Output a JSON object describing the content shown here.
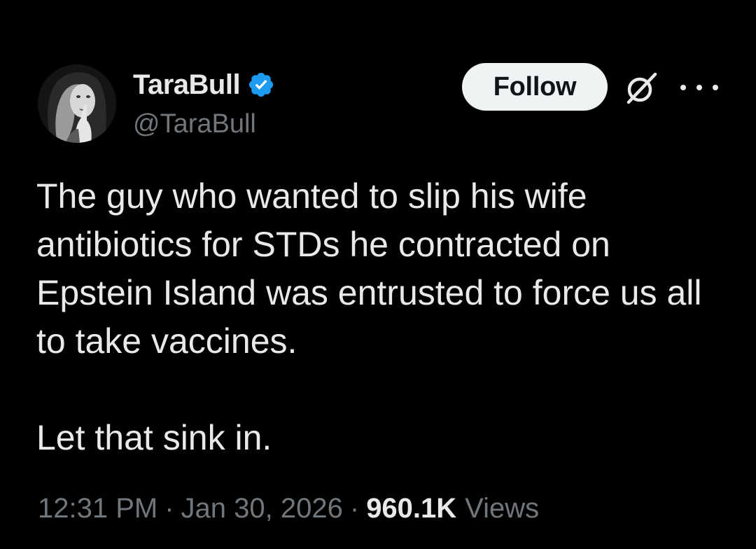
{
  "tweet": {
    "author": {
      "display_name": "TaraBull",
      "handle": "@TaraBull",
      "verified": true,
      "verified_color": "#1d9bf0"
    },
    "follow_label": "Follow",
    "text": "The guy who wanted to slip his wife antibiotics for STDs he contracted on Epstein Island was entrusted to force us all to take vaccines.\n\nLet that sink in.",
    "time": "12:31 PM",
    "separator": "·",
    "date": "Jan 30, 2026",
    "views_count": "960.1K",
    "views_label": "Views"
  },
  "icons": {
    "grok": "grok-icon",
    "more": "more-icon",
    "verified": "verified-badge-icon"
  },
  "colors": {
    "background": "#000000",
    "text_primary": "#e7e9ea",
    "text_secondary": "#71767b",
    "follow_bg": "#eff3f4",
    "follow_text": "#0f1419"
  }
}
